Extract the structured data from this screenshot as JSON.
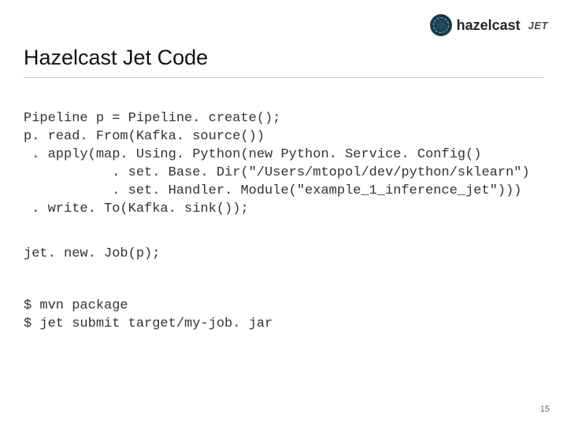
{
  "brand": {
    "name_bold": "hazel",
    "name_rest": "cast",
    "jet": "JET"
  },
  "title": "Hazelcast Jet Code",
  "code_block_1": "Pipeline p = Pipeline. create();\np. read. From(Kafka. source())\n . apply(map. Using. Python(new Python. Service. Config()\n           . set. Base. Dir(\"/Users/mtopol/dev/python/sklearn\")\n           . set. Handler. Module(\"example_1_inference_jet\")))\n . write. To(Kafka. sink());",
  "code_block_2": "jet. new. Job(p);",
  "code_block_3": "$ mvn package\n$ jet submit target/my-job. jar",
  "page_number": "15"
}
